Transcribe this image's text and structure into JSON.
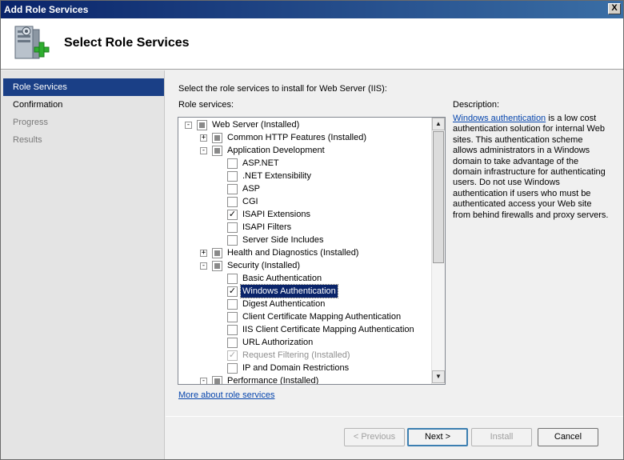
{
  "window": {
    "title": "Add Role Services",
    "close_glyph": "X"
  },
  "header": {
    "title": "Select Role Services",
    "icon": "server-add-icon"
  },
  "nav": {
    "items": [
      {
        "label": "Role Services",
        "state": "active"
      },
      {
        "label": "Confirmation",
        "state": "normal"
      },
      {
        "label": "Progress",
        "state": "disabled"
      },
      {
        "label": "Results",
        "state": "disabled"
      }
    ]
  },
  "main": {
    "instruction": "Select the role services to install for Web Server (IIS):",
    "role_services_label": "Role services:",
    "description_label": "Description:",
    "description_link": "Windows authentication",
    "description_text": " is a low cost authentication solution for internal Web sites. This authentication scheme allows administrators in a Windows domain to take advantage of the domain infrastructure for authenticating users. Do not use Windows authentication if users who must be authenticated access your Web site from behind firewalls and proxy servers.",
    "more_link": "More about role services"
  },
  "tree": [
    {
      "label": "Web Server  (Installed)",
      "level": 0,
      "expander": "-",
      "check": "indeterminate"
    },
    {
      "label": "Common HTTP Features  (Installed)",
      "level": 1,
      "expander": "+",
      "check": "indeterminate"
    },
    {
      "label": "Application Development",
      "level": 1,
      "expander": "-",
      "check": "indeterminate"
    },
    {
      "label": "ASP.NET",
      "level": 2,
      "check": "unchecked"
    },
    {
      "label": ".NET Extensibility",
      "level": 2,
      "check": "unchecked"
    },
    {
      "label": "ASP",
      "level": 2,
      "check": "unchecked"
    },
    {
      "label": "CGI",
      "level": 2,
      "check": "unchecked"
    },
    {
      "label": "ISAPI Extensions",
      "level": 2,
      "check": "checked"
    },
    {
      "label": "ISAPI Filters",
      "level": 2,
      "check": "unchecked"
    },
    {
      "label": "Server Side Includes",
      "level": 2,
      "check": "unchecked"
    },
    {
      "label": "Health and Diagnostics  (Installed)",
      "level": 1,
      "expander": "+",
      "check": "indeterminate"
    },
    {
      "label": "Security  (Installed)",
      "level": 1,
      "expander": "-",
      "check": "indeterminate"
    },
    {
      "label": "Basic Authentication",
      "level": 2,
      "check": "unchecked"
    },
    {
      "label": "Windows Authentication",
      "level": 2,
      "check": "checked",
      "selected": true
    },
    {
      "label": "Digest Authentication",
      "level": 2,
      "check": "unchecked"
    },
    {
      "label": "Client Certificate Mapping Authentication",
      "level": 2,
      "check": "unchecked"
    },
    {
      "label": "IIS Client Certificate Mapping Authentication",
      "level": 2,
      "check": "unchecked"
    },
    {
      "label": "URL Authorization",
      "level": 2,
      "check": "unchecked"
    },
    {
      "label": "Request Filtering  (Installed)",
      "level": 2,
      "check": "checked-disabled"
    },
    {
      "label": "IP and Domain Restrictions",
      "level": 2,
      "check": "unchecked"
    },
    {
      "label": "Performance  (Installed)",
      "level": 1,
      "expander": "-",
      "check": "indeterminate"
    }
  ],
  "buttons": {
    "previous": "< Previous",
    "next": "Next >",
    "install": "Install",
    "cancel": "Cancel"
  },
  "colors": {
    "selection": "#0a246a",
    "nav_active": "#1a3f86",
    "link": "#0645ad"
  }
}
